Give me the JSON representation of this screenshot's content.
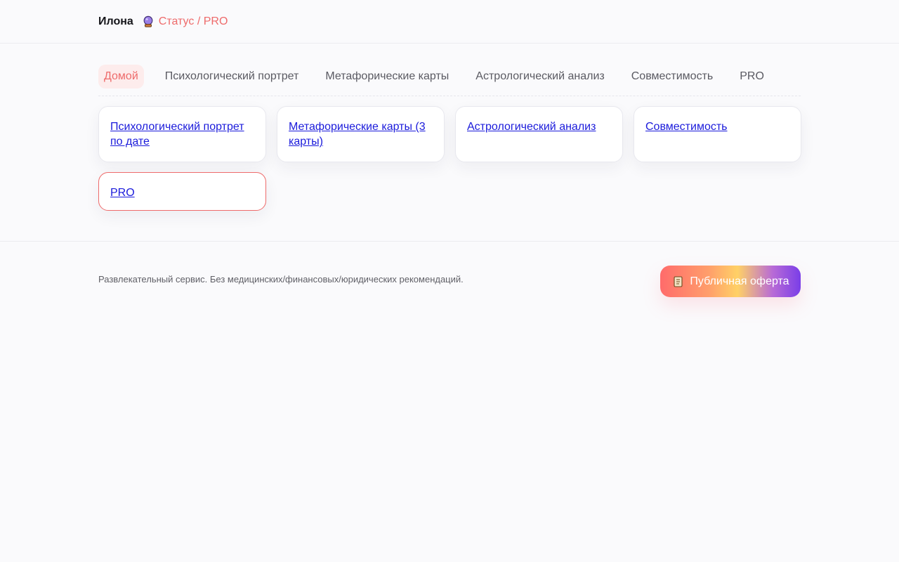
{
  "header": {
    "user_name": "Илона",
    "status_icon": "crystal-ball-icon",
    "status_link": "Статус / PRO"
  },
  "tabs": [
    {
      "label": "Домой",
      "active": true
    },
    {
      "label": "Психологический портрет",
      "active": false
    },
    {
      "label": "Метафорические карты",
      "active": false
    },
    {
      "label": "Астрологический анализ",
      "active": false
    },
    {
      "label": "Совместимость",
      "active": false
    },
    {
      "label": "PRO",
      "active": false
    }
  ],
  "cards": [
    {
      "label": "Психологический портрет по дате"
    },
    {
      "label": "Метафорические карты (3 карты)"
    },
    {
      "label": "Астрологический анализ"
    },
    {
      "label": "Совместимость"
    },
    {
      "label": "PRO"
    }
  ],
  "footer": {
    "disclaimer": "Развлекательный сервис. Без медицинских/финансовых/юридических рекомендаций.",
    "offer_icon": "scroll-icon",
    "offer_label": "Публичная оферта"
  },
  "colors": {
    "accent": "#ee6b6b",
    "link": "#1a1adb",
    "background": "#fafafc"
  }
}
